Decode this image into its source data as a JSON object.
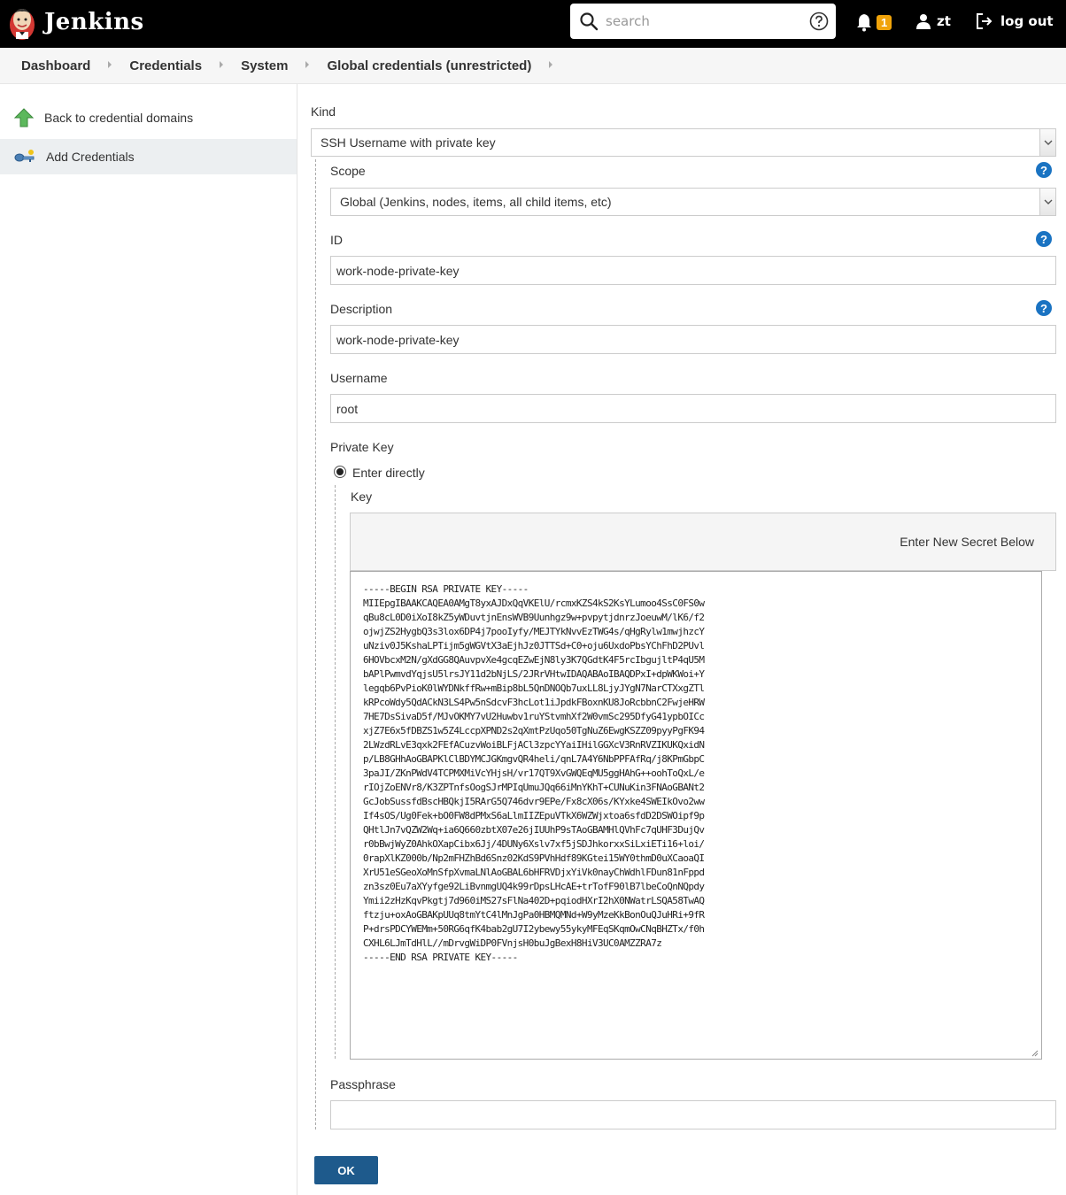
{
  "header": {
    "app_name": "Jenkins",
    "search_placeholder": "search",
    "notification_count": "1",
    "user_name": "zt",
    "logout_label": "log out"
  },
  "breadcrumb": [
    "Dashboard",
    "Credentials",
    "System",
    "Global credentials (unrestricted)"
  ],
  "sidebar": {
    "items": [
      {
        "label": "Back to credential domains",
        "icon": "up-arrow-icon"
      },
      {
        "label": "Add Credentials",
        "icon": "key-icon"
      }
    ]
  },
  "form": {
    "kind_label": "Kind",
    "kind_value": "SSH Username with private key",
    "scope_label": "Scope",
    "scope_value": "Global (Jenkins, nodes, items, all child items, etc)",
    "id_label": "ID",
    "id_value": "work-node-private-key",
    "description_label": "Description",
    "description_value": "work-node-private-key",
    "username_label": "Username",
    "username_value": "root",
    "private_key_label": "Private Key",
    "enter_directly_label": "Enter directly",
    "key_label": "Key",
    "key_header_text": "Enter New Secret Below",
    "key_value": "-----BEGIN RSA PRIVATE KEY-----\nMIIEpgIBAAKCAQEA0AMgT8yxAJDxQqVKElU/rcmxKZS4kS2KsYLumoo4SsC0FS0w\nqBu8cL0D0iXoI8kZ5yWDuvtjnEnsWVB9Uunhgz9w+pvpytjdnrzJoeuwM/lK6/f2\nojwjZS2HygbQ3s3lox6DP4j7pooIyfy/MEJTYkNvvEzTWG4s/qHgRylw1mwjhzcY\nuNziv0J5KshaLPTijm5gWGVtX3aEjhJz0JTTSd+C0+oju6UxdoPbsYChFhD2PUvl\n6HOVbcxM2N/gXdGG8QAuvpvXe4gcqEZwEjN8ly3K7QGdtK4F5rcIbgujltP4qU5M\nbAPlPwmvdYqjsU5lrsJY11d2bNjLS/2JRrVHtwIDAQABAoIBAQDPxI+dpWKWoi+Y\nlegqb6PvPioK0lWYDNkffRw+mBip8bL5QnDNOQb7uxLL8LjyJYgN7NarCTXxgZTl\nkRPcoWdy5QdACkN3LS4Pw5nSdcvF3hcLot1iJpdkFBoxnKU8JoRcbbnC2FwjeHRW\n7HE7DsSivaD5f/MJvOKMY7vU2Huwbv1ruYStvmhXf2W0vmSc295DfyG41ypbOICc\nxjZ7E6x5fDBZS1w5Z4LccpXPND2s2qXmtPzUqo50TgNuZ6EwgKSZZ09pyyPgFK94\n2LWzdRLvE3qxk2FEfACuzvWoiBLFjACl3zpcYYaiIHilGGXcV3RnRVZIKUKQxidN\np/LB8GHhAoGBAPKlClBDYMCJGKmgvQR4heli/qnL7A4Y6NbPPFAfRq/j8KPmGbpC\n3paJI/ZKnPWdV4TCPMXMiVcYHjsH/vr17QT9XvGWQEqMU5ggHAhG++oohToQxL/e\nrIOjZoENVr8/K3ZPTnfsOogSJrMPIqUmuJQq66iMnYKhT+CUNuKin3FNAoGBANt2\nGcJobSussfdBscHBQkjI5RArG5Q746dvr9EPe/Fx8cX06s/KYxke4SWEIkOvo2ww\nIf4sOS/Ug0Fek+bO0FW8dPMxS6aLlmIIZEpuVTkX6WZWjxtoa6sfdD2DSWOipf9p\nQHtlJn7vQZW2Wq+ia6Q660zbtX07e26jIUUhP9sTAoGBAMHlQVhFc7qUHF3DujQv\nr0bBwjWyZ0AhkOXapCibx6Jj/4DUNy6Xslv7xf5jSDJhkorxxSiLxiETi16+loi/\n0rapXlKZ000b/Np2mFHZhBd6Snz02KdS9PVhHdf89KGtei15WY0thmD0uXCaoaQI\nXrU51eSGeoXoMnSfpXvmaLNlAoGBAL6bHFRVDjxYiVk0nayChWdhlFDun81nFppd\nzn3sz0Eu7aXYyfge92LiBvnmgUQ4k99rDpsLHcAE+trTofF90lB7lbeCoQnNQpdy\nYmii2zHzKqvPkgtj7d960iMS27sFlNa402D+pqiodHXrI2hX0NWatrLSQA58TwAQ\nftzju+oxAoGBAKpUUq8tmYtC4lMnJgPa0HBMQMNd+W9yMzeKkBonOuQJuHRi+9fR\nP+drsPDCYWEMm+50RG6qfK4bab2gU7I2ybewy55ykyMFEqSKqmOwCNqBHZTx/f0h\nCXHL6LJmTdHlL//mDrvgWiDP0FVnjsH0buJgBexH8HiV3UC0AMZZRA7z\n-----END RSA PRIVATE KEY-----",
    "passphrase_label": "Passphrase",
    "passphrase_value": "",
    "ok_label": "OK"
  },
  "colors": {
    "header_bg": "#000000",
    "notification_badge": "#f0a30a",
    "help_icon": "#1a73c2",
    "ok_button": "#1e5a8c"
  }
}
